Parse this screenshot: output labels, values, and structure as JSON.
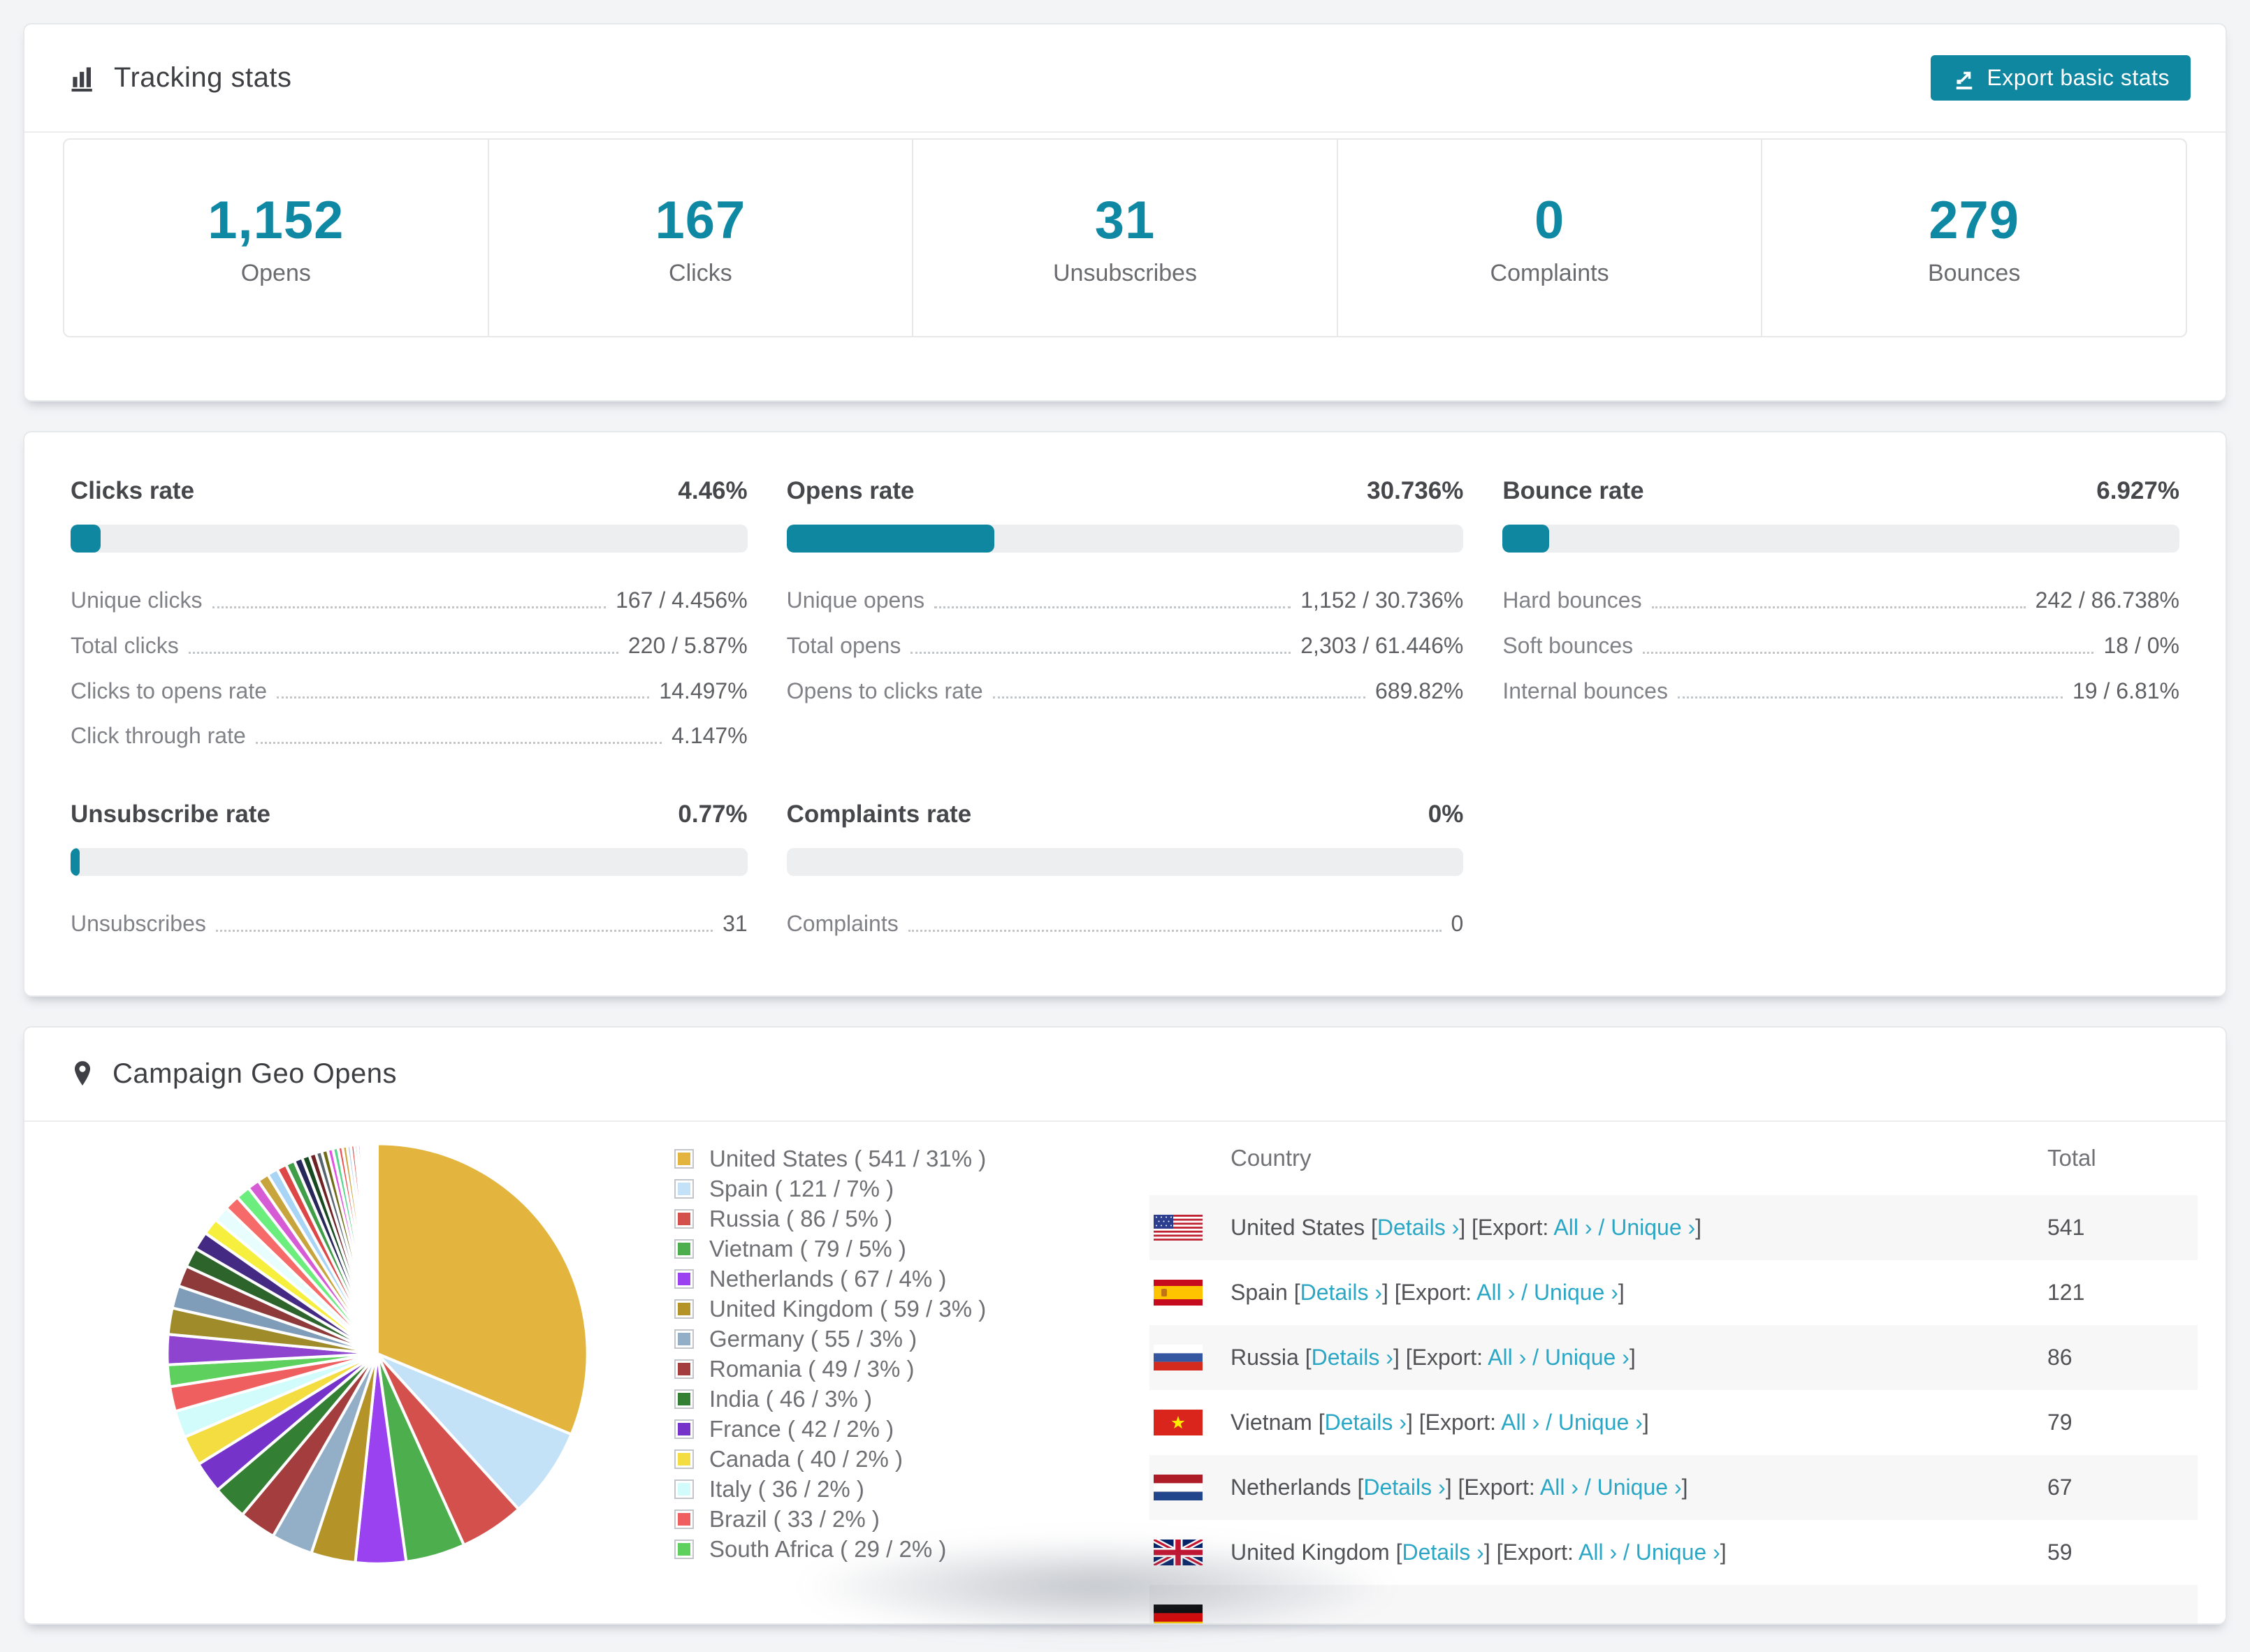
{
  "page": {
    "colors": {
      "accent": "#0f87a0",
      "link": "#2ba7c6",
      "stat_number": "#0f88a3"
    }
  },
  "tracking": {
    "title": "Tracking stats",
    "export_button": "Export basic stats",
    "stats": [
      {
        "value": "1,152",
        "label": "Opens"
      },
      {
        "value": "167",
        "label": "Clicks"
      },
      {
        "value": "31",
        "label": "Unsubscribes"
      },
      {
        "value": "0",
        "label": "Complaints"
      },
      {
        "value": "279",
        "label": "Bounces"
      }
    ]
  },
  "rates": [
    {
      "title": "Clicks rate",
      "value": "4.46%",
      "pct": 4.46,
      "rows": [
        {
          "label": "Unique clicks",
          "value": "167 / 4.456%"
        },
        {
          "label": "Total clicks",
          "value": "220 / 5.87%"
        },
        {
          "label": "Clicks to opens rate",
          "value": "14.497%"
        },
        {
          "label": "Click through rate",
          "value": "4.147%"
        }
      ]
    },
    {
      "title": "Opens rate",
      "value": "30.736%",
      "pct": 30.736,
      "rows": [
        {
          "label": "Unique opens",
          "value": "1,152 / 30.736%"
        },
        {
          "label": "Total opens",
          "value": "2,303 / 61.446%"
        },
        {
          "label": "Opens to clicks rate",
          "value": "689.82%"
        }
      ]
    },
    {
      "title": "Bounce rate",
      "value": "6.927%",
      "pct": 6.927,
      "rows": [
        {
          "label": "Hard bounces",
          "value": "242 / 86.738%"
        },
        {
          "label": "Soft bounces",
          "value": "18 / 0%"
        },
        {
          "label": "Internal bounces",
          "value": "19 / 6.81%"
        }
      ]
    },
    {
      "title": "Unsubscribe rate",
      "value": "0.77%",
      "pct": 0.77,
      "rows": [
        {
          "label": "Unsubscribes",
          "value": "31"
        }
      ]
    },
    {
      "title": "Complaints rate",
      "value": "0%",
      "pct": 0,
      "rows": [
        {
          "label": "Complaints",
          "value": "0"
        }
      ]
    }
  ],
  "geo": {
    "title": "Campaign Geo Opens",
    "columns": [
      "Country",
      "Total"
    ],
    "links": {
      "details": "Details ›",
      "export_label": "Export:",
      "all": "All ›",
      "slash": "/",
      "unique": "Unique ›"
    },
    "rows": [
      {
        "flag": "us",
        "country": "United States",
        "total": "541"
      },
      {
        "flag": "es",
        "country": "Spain",
        "total": "121"
      },
      {
        "flag": "ru",
        "country": "Russia",
        "total": "86"
      },
      {
        "flag": "vn",
        "country": "Vietnam",
        "total": "79"
      },
      {
        "flag": "nl",
        "country": "Netherlands",
        "total": "67"
      },
      {
        "flag": "gb",
        "country": "United Kingdom",
        "total": "59"
      },
      {
        "flag": "de",
        "country": "",
        "total": ""
      }
    ],
    "chart_data": {
      "type": "pie",
      "title": "Campaign Geo Opens",
      "legend_position": "right",
      "start_angle_deg": 0,
      "direction": "clockwise",
      "slices": [
        {
          "label": "United States",
          "count": 541,
          "pct": "31%",
          "color": "#e3b53e"
        },
        {
          "label": "Spain",
          "count": 121,
          "pct": "7%",
          "color": "#c3e1f7"
        },
        {
          "label": "Russia",
          "count": 86,
          "pct": "5%",
          "color": "#d4504c"
        },
        {
          "label": "Vietnam",
          "count": 79,
          "pct": "5%",
          "color": "#4cae4c"
        },
        {
          "label": "Netherlands",
          "count": 67,
          "pct": "4%",
          "color": "#9b42f0"
        },
        {
          "label": "United Kingdom",
          "count": 59,
          "pct": "3%",
          "color": "#b49429"
        },
        {
          "label": "Germany",
          "count": 55,
          "pct": "3%",
          "color": "#92afc7"
        },
        {
          "label": "Romania",
          "count": 49,
          "pct": "3%",
          "color": "#a43d3d"
        },
        {
          "label": "India",
          "count": 46,
          "pct": "3%",
          "color": "#337f33"
        },
        {
          "label": "France",
          "count": 42,
          "pct": "2%",
          "color": "#7633c9"
        },
        {
          "label": "Canada",
          "count": 40,
          "pct": "2%",
          "color": "#f4dd40"
        },
        {
          "label": "Italy",
          "count": 36,
          "pct": "2%",
          "color": "#d2fbfb"
        },
        {
          "label": "Brazil",
          "count": 33,
          "pct": "2%",
          "color": "#ef5f5f"
        },
        {
          "label": "South Africa",
          "count": 29,
          "pct": "2%",
          "color": "#5dd05d"
        }
      ],
      "unlabeled_tail_slices": {
        "values": [
          40,
          35,
          30,
          28,
          26,
          24,
          22,
          21,
          20,
          19,
          16,
          15,
          14,
          13,
          12,
          11,
          10,
          9,
          8,
          8,
          7,
          7,
          6,
          6,
          5,
          5,
          4,
          4,
          3,
          3,
          3,
          2,
          2,
          2,
          2,
          1,
          1,
          1,
          1,
          1
        ],
        "colors": [
          "#8e44cf",
          "#a08b2b",
          "#7f9db9",
          "#8e3a3a",
          "#2c642c",
          "#452a84",
          "#f7ef3e",
          "#e8fdfd",
          "#f66a6a",
          "#6bee7e",
          "#d65cd6",
          "#c8a43c",
          "#a8d4f5",
          "#de4747",
          "#3f9e47",
          "#27275a",
          "#184a20",
          "#6e2222",
          "#56646f",
          "#6f6b17",
          "#e44fe4",
          "#58d68d",
          "#ef5050",
          "#cfa53f",
          "#aacdef",
          "#e05050",
          "#4cae4c",
          "#9b42f5",
          "#b49429",
          "#92afc7",
          "#a43d3d",
          "#337f33",
          "#7633c9",
          "#f4dd40",
          "#d2fbfb",
          "#ef5f5f",
          "#5dd05d",
          "#c9a0f0",
          "#e6e6fa",
          "#dcd0f5"
        ]
      }
    }
  }
}
